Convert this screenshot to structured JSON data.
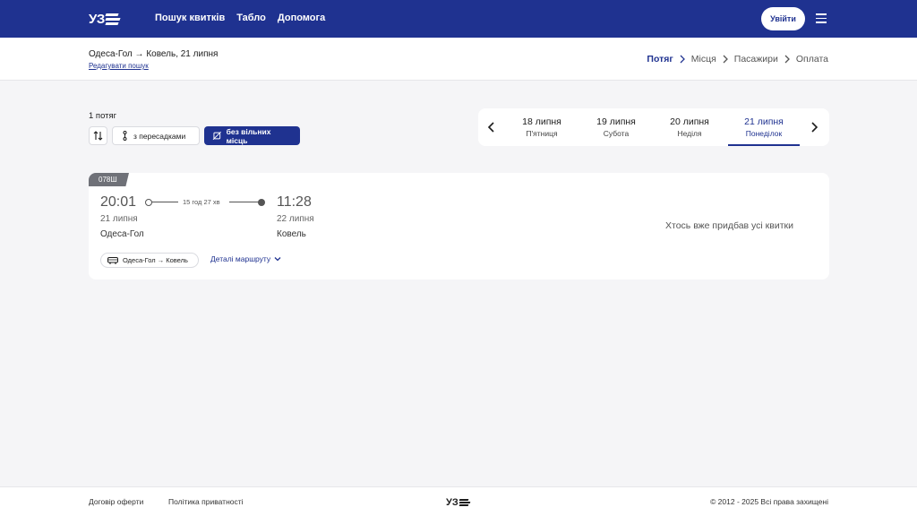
{
  "header": {
    "logo_text": "УЗ",
    "nav": [
      "Пошук квитків",
      "Табло",
      "Допомога"
    ],
    "login_label": "Увійти"
  },
  "subheader": {
    "route_title": "Одеса-Гол → Ковель, 21 липня",
    "edit_search": "Редагувати пошук",
    "steps": [
      {
        "label": "Потяг",
        "active": true
      },
      {
        "label": "Місця",
        "active": false
      },
      {
        "label": "Пасажири",
        "active": false
      },
      {
        "label": "Оплата",
        "active": false
      }
    ]
  },
  "filters": {
    "count_label": "1 потяг",
    "transfer_label": "з пересадками",
    "no_seats_label": "без вільних місць"
  },
  "datepicker": {
    "days": [
      {
        "date": "18 липня",
        "weekday": "П'ятниця",
        "active": false
      },
      {
        "date": "19 липня",
        "weekday": "Субота",
        "active": false
      },
      {
        "date": "20 липня",
        "weekday": "Неділя",
        "active": false
      },
      {
        "date": "21 липня",
        "weekday": "Понеділок",
        "active": true
      }
    ]
  },
  "train": {
    "number": "078Ш",
    "departure_time": "20:01",
    "departure_date": "21 липня",
    "departure_station": "Одеса-Гол",
    "duration": "15 год 27 хв",
    "arrival_time": "11:28",
    "arrival_date": "22 липня",
    "arrival_station": "Ковель",
    "route_chip": "Одеса-Гол → Ковель",
    "route_details": "Деталі маршруту",
    "status": "Хтось вже придбав усі квитки"
  },
  "footer": {
    "offer": "Договір оферти",
    "privacy": "Політика приватності",
    "logo_text": "УЗ",
    "copyright": "© 2012 - 2025 Всі права захищені"
  },
  "colors": {
    "brand": "#1f3290",
    "background": "#f5f5f7"
  }
}
